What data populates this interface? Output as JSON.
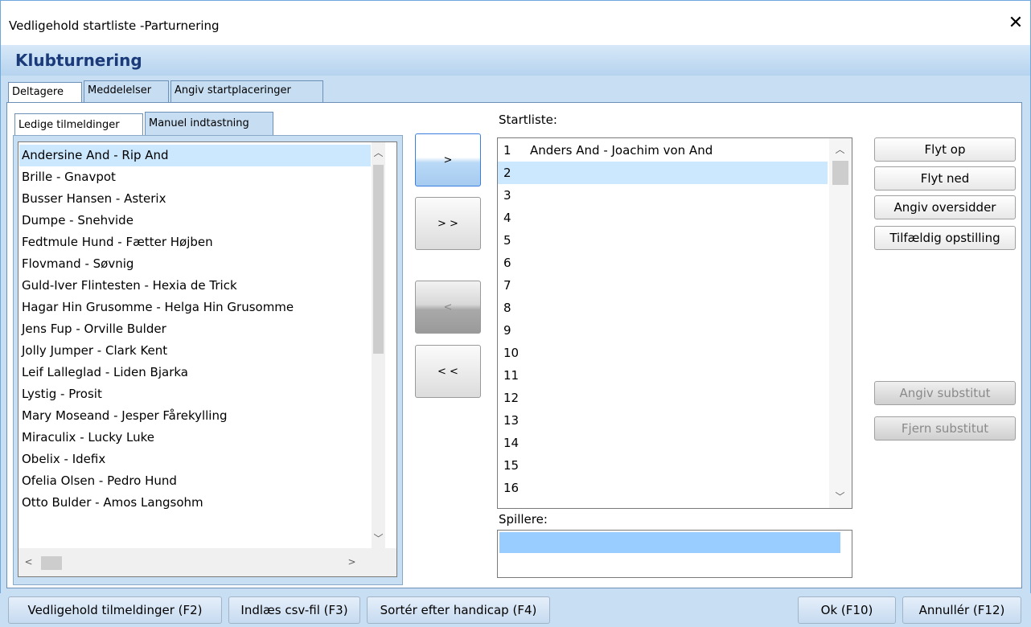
{
  "window": {
    "title": "Vedligehold startliste -Parturnering",
    "close_glyph": "✕"
  },
  "header": {
    "title": "Klubturnering"
  },
  "tabs": [
    {
      "label": "Deltagere",
      "active": true
    },
    {
      "label": "Meddelelser",
      "active": false
    },
    {
      "label": "Angiv startplaceringer",
      "active": false
    }
  ],
  "subtabs": [
    {
      "label": "Ledige tilmeldinger",
      "active": true
    },
    {
      "label": "Manuel indtastning",
      "active": false
    }
  ],
  "available": {
    "selected_index": 0,
    "items": [
      "Andersine And - Rip And",
      "Brille - Gnavpot",
      "Busser Hansen - Asterix",
      "Dumpe - Snehvide",
      "Fedtmule Hund - Fætter Højben",
      "Flovmand - Søvnig",
      "Guld-Iver Flintesten - Hexia de Trick",
      "Hagar Hin Grusomme - Helga Hin Grusomme",
      "Jens Fup - Orville Bulder",
      "Jolly Jumper - Clark Kent",
      "Leif Lalleglad - Liden Bjarka",
      "Lystig - Prosit",
      "Mary Moseand - Jesper Fårekylling",
      "Miraculix - Lucky Luke",
      "Obelix - Idefix",
      "Ofelia Olsen - Pedro Hund",
      "Otto Bulder - Amos Langsohm"
    ]
  },
  "move_buttons": {
    "add_one": ">",
    "add_all": "> >",
    "remove_one": "<",
    "remove_all": "< <"
  },
  "startlist": {
    "label": "Startliste:",
    "selected_index": 1,
    "rows": [
      {
        "num": "1",
        "name": "Anders And - Joachim von And"
      },
      {
        "num": "2",
        "name": ""
      },
      {
        "num": "3",
        "name": ""
      },
      {
        "num": "4",
        "name": ""
      },
      {
        "num": "5",
        "name": ""
      },
      {
        "num": "6",
        "name": ""
      },
      {
        "num": "7",
        "name": ""
      },
      {
        "num": "8",
        "name": ""
      },
      {
        "num": "9",
        "name": ""
      },
      {
        "num": "10",
        "name": ""
      },
      {
        "num": "11",
        "name": ""
      },
      {
        "num": "12",
        "name": ""
      },
      {
        "num": "13",
        "name": ""
      },
      {
        "num": "14",
        "name": ""
      },
      {
        "num": "15",
        "name": ""
      },
      {
        "num": "16",
        "name": ""
      }
    ]
  },
  "players": {
    "label": "Spillere:"
  },
  "side_buttons": {
    "move_up": "Flyt op",
    "move_down": "Flyt ned",
    "set_bye": "Angiv oversidder",
    "random": "Tilfældig opstilling",
    "set_substitute": "Angiv substitut",
    "remove_substitute": "Fjern substitut"
  },
  "bottom_buttons": {
    "maintain": "Vedligehold tilmeldinger (F2)",
    "import_csv": "Indlæs csv-fil (F3)",
    "sort_handicap": "Sortér efter handicap (F4)",
    "ok": "Ok (F10)",
    "cancel": "Annullér (F12)"
  },
  "scroll_glyphs": {
    "up": "︿",
    "down": "﹀",
    "left": "<",
    "right": ">"
  }
}
